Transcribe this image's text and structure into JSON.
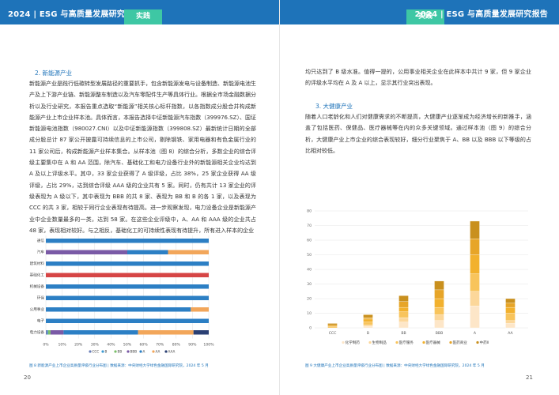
{
  "header": {
    "title": "2024 | ESG 与高质量发展研究报告",
    "tab_label": "实践",
    "bg_color": "#1e73b9",
    "tab_color": "#3ec7a4"
  },
  "left_page": {
    "section_title": "2. 新能源产业",
    "paragraphs": [
      "新能源产业是践行低碳转型发展路径的重要抓手，包含新能源发电与设备制造、新能源电池生产及上下游产业链、新能源整车制造以及汽车零配件生产等具体行业。根据全市场金融数据分析以及行业研究，本报告重点选取“新能源”相关核心标杆指数，以各指数成分股合并构成新能源产业上市企业样本池。具体而言，本报告选择中证新能源汽车指数（399976.SZ）、国证新能源电池指数（980027.CNI）以及中证新能源指数（399808.SZ）最新统计日期的全部成分股总计 87 家公开披露可持续信息的上市公司，剔除钢铁、家用电器和有色金属行业的 11 家公司后，构成新能源产业样本集合。从样本池（图 8）的综合分析，多数企业的综合评级主要集中在 A 和 AA 范围，除汽车、基础化工和电力设备行业外的新能源相关企业均达到 A 及以上评级水平。其中，33 家企业获得了 A 级评级，占比 38%，25 家企业获得 AA 级评级，占比 29%，达到综合评级 AAA 级的企业共有 5 家。同时，仍有共计 13 家企业的评级表现为 A 级以下，其中表现为 BBB 的共 8 家、表现为 BB 和 B 的各 1 家，以及表现为 CCC 的共 3 家，相较于同行企业表现有待提高。进一步观察发现，电力设备企业是新能源产业中企业数量最多的一类，达到 58 家。在这些企业评级中，A、AA 和 AAA 级的企业共占 48 家，表现相对较好。与之相反，基础化工的可持续性表现有待提升，所有进入样本的企业"
    ],
    "caption": "图 8 新能源产业上市企业高质量评级行业分布图 | 数据来源：中央财经大学绿色金融国际研究院，2024 年 5 月",
    "page_number": "20"
  },
  "right_page": {
    "intro_text": "均只达到了 B 级水准。值得一提的，公用事业相关企业在此样本中共计 9 家，但 9 家企业的评级水平均在 A 及 A 以上，显示其行业突出表现。",
    "section_title": "3. 大健康产业",
    "paragraph": "随着人口老龄化和人们对健康需求的不断提高，大健康产业逐渐成为经济增长的新推手，涵盖了包括医药、保健品、医疗器械等在内的众多关键领域。通过样本池（图 9）的综合分析，大健康产业上市企业的综合表现较好，细分行业聚焦于 A、BB 以及 BBB 以下等级的占比相对较低。",
    "caption": "图 9 大健康产业上市企业高质量评级行业分布图 | 数据来源：中央财经大学绿色金融国际研究院，2024 年 5 月",
    "page_number": "21"
  },
  "chart_data": [
    {
      "type": "bar",
      "orientation": "horizontal",
      "stacked": "percent",
      "categories": [
        "电力设备",
        "电子",
        "公用事业",
        "环保",
        "机械设备",
        "基础化工",
        "建筑材料",
        "汽车",
        "通信"
      ],
      "series": [
        {
          "name": "CCC",
          "color": "#6b7fb8",
          "values": [
            0.9,
            0,
            0,
            0,
            0,
            0,
            0,
            0,
            0
          ]
        },
        {
          "name": "B",
          "color": "#3f9bd2",
          "values": [
            0.4,
            0,
            0,
            0,
            0,
            0,
            0,
            0,
            0
          ]
        },
        {
          "name": "BB",
          "color": "#7bbf6a",
          "values": [
            1.4,
            0,
            0,
            0,
            0,
            0,
            0,
            0,
            0
          ]
        },
        {
          "name": "BBB",
          "color": "#7a5aa6",
          "values": [
            7.5,
            0,
            0,
            0,
            0,
            0,
            0,
            50,
            0
          ]
        },
        {
          "name": "A",
          "color": "#2c7fc4",
          "values": [
            43,
            100,
            89,
            100,
            100,
            0,
            100,
            25,
            100
          ]
        },
        {
          "name": "AA",
          "color": "#f2a65a",
          "values": [
            32,
            0,
            11,
            0,
            0,
            0,
            0,
            25,
            0
          ]
        },
        {
          "name": "AAA",
          "color": "#2a3f73",
          "values": [
            8.8,
            0,
            0,
            0,
            0,
            0,
            0,
            0,
            0
          ]
        },
        {
          "name": "B*",
          "color": "#d64545",
          "values": [
            0,
            0,
            0,
            0,
            0,
            100,
            0,
            0,
            0
          ]
        }
      ],
      "x_ticks": [
        "0%",
        "10%",
        "20%",
        "30%",
        "40%",
        "50%",
        "60%",
        "70%",
        "80%",
        "90%",
        "100%"
      ],
      "legend": [
        "CCC",
        "B",
        "BB",
        "BBB",
        "A",
        "AA",
        "AAA"
      ],
      "xlim": [
        0,
        100
      ],
      "grid": true,
      "legend_position": "bottom"
    },
    {
      "type": "bar",
      "stacked": true,
      "categories": [
        "CCC",
        "B",
        "BB",
        "BBB",
        "A",
        "AA"
      ],
      "series": [
        {
          "name": "化学制药",
          "color": "#fde6c8",
          "values": [
            0,
            1,
            4,
            5,
            15,
            3
          ]
        },
        {
          "name": "生物制品",
          "color": "#fcd79a",
          "values": [
            0,
            1,
            3,
            4,
            10,
            2
          ]
        },
        {
          "name": "医疗服务",
          "color": "#f8c45c",
          "values": [
            1,
            2,
            4,
            5,
            12,
            5
          ]
        },
        {
          "name": "医疗器械",
          "color": "#f2b12e",
          "values": [
            0,
            2,
            3,
            6,
            13,
            4
          ]
        },
        {
          "name": "医药商业",
          "color": "#e7a528",
          "values": [
            1,
            1,
            4,
            6,
            11,
            3
          ]
        },
        {
          "name": "中药Ⅱ",
          "color": "#c9901e",
          "values": [
            1,
            2,
            4,
            6,
            12,
            3
          ]
        }
      ],
      "y_ticks": [
        0,
        10,
        20,
        30,
        40,
        50,
        60,
        70,
        80
      ],
      "ylim": [
        0,
        80
      ],
      "grid": true,
      "legend_position": "bottom"
    }
  ]
}
